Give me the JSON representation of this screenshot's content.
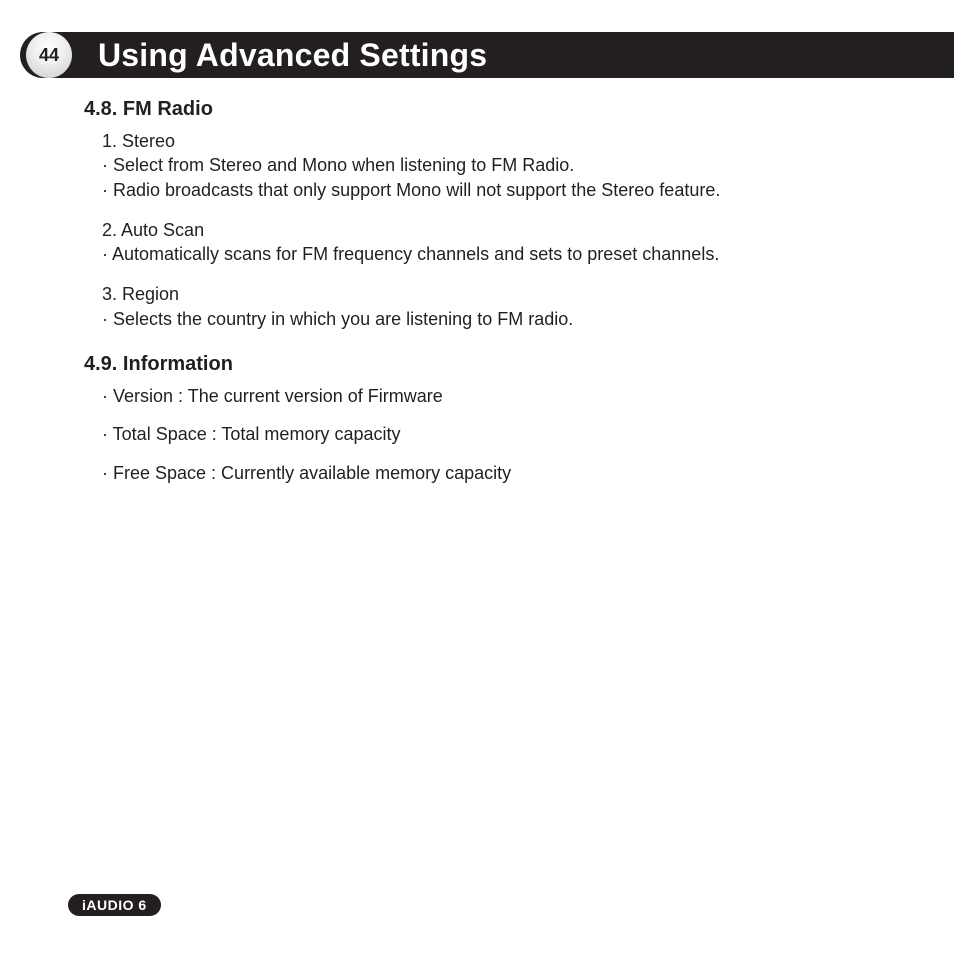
{
  "header": {
    "page_number": "44",
    "title": "Using Advanced Settings"
  },
  "sections": {
    "fm_radio": {
      "heading": "4.8. FM Radio",
      "items": {
        "stereo": {
          "num": "1. Stereo",
          "b1": "Select from Stereo and Mono when listening to FM Radio.",
          "b2": "Radio broadcasts that only support Mono will not support the Stereo feature."
        },
        "autoscan": {
          "num": "2. Auto Scan",
          "b1": "Automatically scans for FM frequency channels and sets to preset channels."
        },
        "region": {
          "num": "3. Region",
          "b1": "Selects the country in which you are listening to FM radio."
        }
      }
    },
    "information": {
      "heading": "4.9. Information",
      "b1": "Version : The current version of Firmware",
      "b2": "Total Space : Total memory capacity",
      "b3": "Free Space : Currently available memory capacity"
    }
  },
  "footer": {
    "badge": "iAUDIO 6"
  }
}
